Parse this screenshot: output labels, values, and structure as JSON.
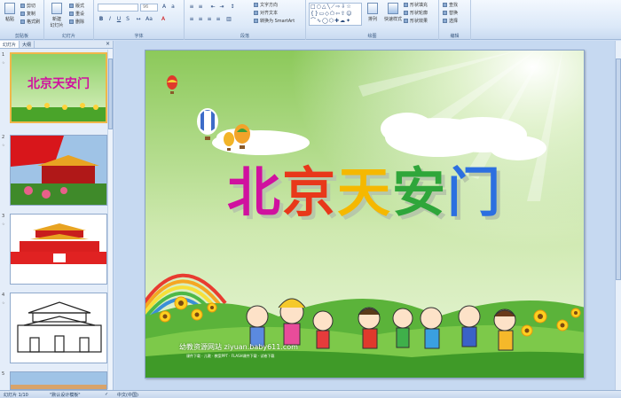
{
  "ribbon": {
    "groups": [
      {
        "label": "剪贴板"
      },
      {
        "label": "幻灯片"
      },
      {
        "label": "字体"
      },
      {
        "label": "段落"
      },
      {
        "label": "绘图"
      },
      {
        "label": "编辑"
      }
    ],
    "clipboard": {
      "paste": "粘贴",
      "cut": "剪切",
      "copy": "复制",
      "format_painter": "格式刷"
    },
    "slides": {
      "new_slide": "新建\n幻灯片",
      "layout": "版式",
      "reset": "重设",
      "delete": "删除"
    },
    "font": {
      "font_name": "",
      "font_size": "96"
    },
    "paragraph": {
      "text_direction": "文字方向",
      "align_text": "对齐文本",
      "smartart": "转换为 SmartArt"
    },
    "drawing": {
      "arrange": "排列",
      "quick_styles": "快速样式",
      "shape_fill": "形状填充",
      "shape_outline": "形状轮廓",
      "shape_effects": "形状效果"
    },
    "editing": {
      "find": "查找",
      "replace": "替换",
      "select": "选择"
    }
  },
  "panel": {
    "tab_slides": "幻灯片",
    "tab_outline": "大纲",
    "close": "×",
    "thumbnails": [
      {
        "num": "1"
      },
      {
        "num": "2"
      },
      {
        "num": "3"
      },
      {
        "num": "4"
      },
      {
        "num": "5"
      }
    ]
  },
  "slide": {
    "title_chars": [
      "北",
      "京",
      "天",
      "安",
      "门"
    ],
    "title_colors": [
      "#d0119f",
      "#e8381a",
      "#f5b800",
      "#2fa63a",
      "#2c6fe0"
    ],
    "watermark": "幼教资源网站  ziyuan.baby611.com",
    "watermark_sub": "课件下载 · 儿歌 · 教案PPT · FLASH课件下载 · 试卷下载"
  },
  "status": {
    "slide_info": "幻灯片 1/10",
    "theme": "\"默认设计模板\"",
    "language": "中文(中国)"
  }
}
